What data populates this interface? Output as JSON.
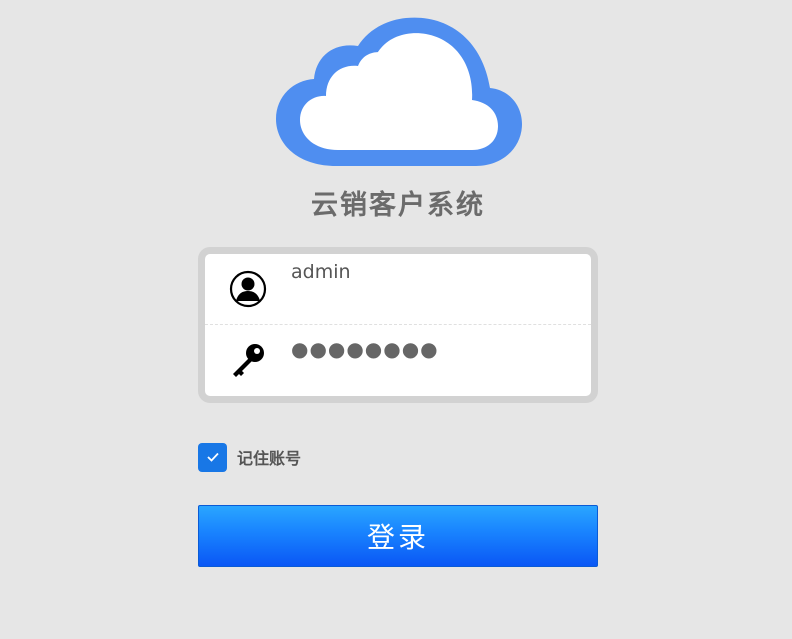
{
  "app": {
    "title": "云销客户系统",
    "logo_icon": "cloud-icon",
    "brand_color": "#4f8ef0"
  },
  "form": {
    "username": {
      "value": "admin",
      "icon": "user-icon"
    },
    "password": {
      "value": "●●●●●●●●",
      "icon": "key-icon"
    },
    "remember": {
      "label": "记住账号",
      "checked": true
    },
    "login_label": "登录"
  }
}
